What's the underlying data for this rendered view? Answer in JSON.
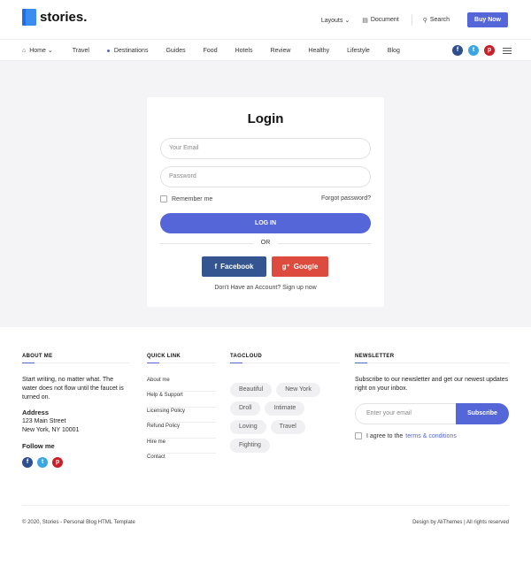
{
  "header": {
    "logo_text": "stories.",
    "links": [
      {
        "label": "Layouts ⌄",
        "icon": ""
      },
      {
        "label": "Document",
        "icon": "document-icon"
      },
      {
        "label": "Search",
        "icon": "search-icon"
      }
    ],
    "buy_label": "Buy Now"
  },
  "nav": {
    "items": [
      "Home ⌄",
      "Travel",
      "Destinations",
      "Guides",
      "Food",
      "Hotels",
      "Review",
      "Healthy",
      "Lifestyle",
      "Blog"
    ],
    "social": [
      "f",
      "t",
      "p"
    ]
  },
  "login": {
    "title": "Login",
    "email_placeholder": "Your Email",
    "password_placeholder": "Password",
    "remember_label": "Remember me",
    "forgot_label": "Forgot password?",
    "login_button": "LOG IN",
    "or_text": "OR",
    "facebook_label": "Facebook",
    "google_label": "Google",
    "signup_text": "Don't Have an Account? Sign up now"
  },
  "footer": {
    "about": {
      "heading": "ABOUT ME",
      "text": "Start writing, no matter what. The water does not flow until the faucet is turned on.",
      "address_heading": "Address",
      "address_line1": "123 Main Street",
      "address_line2": "New York, NY 10001",
      "follow_heading": "Follow me"
    },
    "quick": {
      "heading": "QUICK LINK",
      "links": [
        "About me",
        "Help & Support",
        "Licensing Policy",
        "Refund Policy",
        "Hire me",
        "Contact"
      ]
    },
    "tags": {
      "heading": "TAGCLOUD",
      "items": [
        "Beautiful",
        "New York",
        "Droll",
        "Intimate",
        "Loving",
        "Travel",
        "Fighting"
      ]
    },
    "newsletter": {
      "heading": "NEWSLETTER",
      "intro": "Subscribe to our newsletter and get our newest updates right on your inbox.",
      "email_placeholder": "Enter your email",
      "subscribe_label": "Subscribe",
      "agree_text": "I agree to the",
      "terms_text": "terms & conditions"
    },
    "copyright": "© 2020, Stories - Personal Blog HTML Template",
    "design_credit": "Design by AliThemes | All rights reserved"
  },
  "colors": {
    "accent": "#5567d8",
    "facebook": "#34558f",
    "google": "#dd4b3e",
    "twitter": "#3ba6e6",
    "pinterest": "#c81f28"
  }
}
